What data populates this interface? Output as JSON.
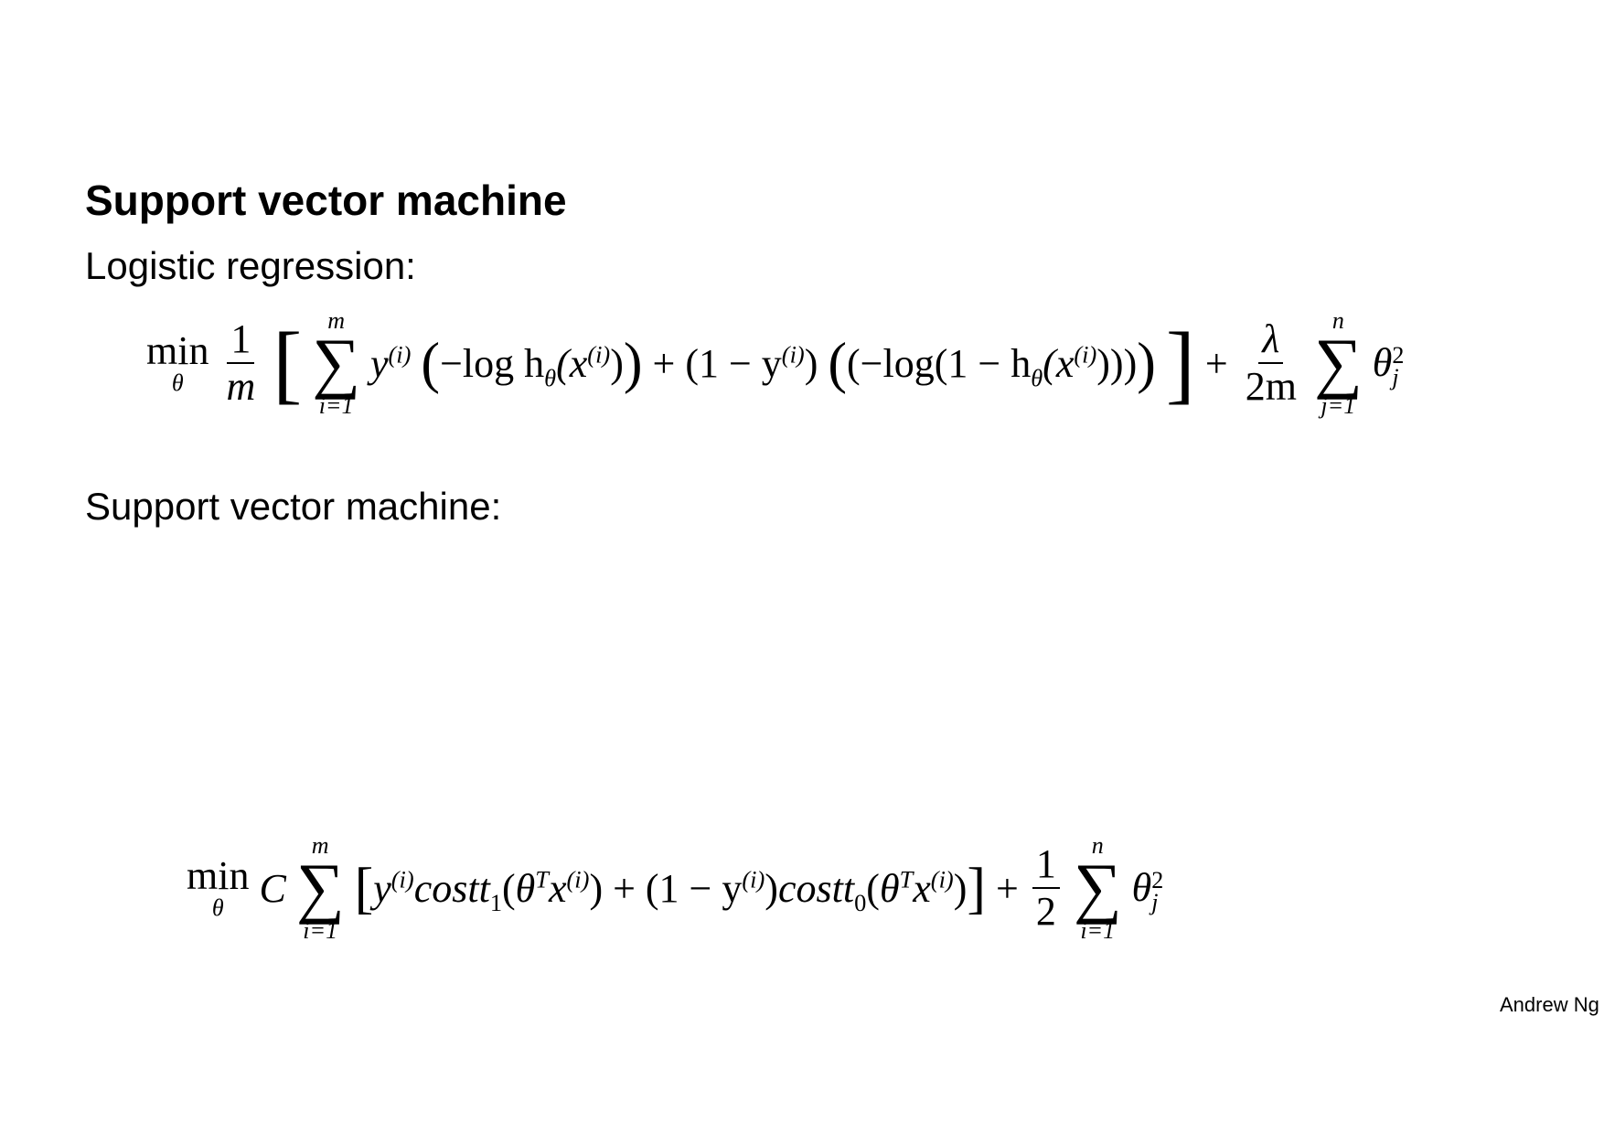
{
  "slide": {
    "title": "Support vector machine",
    "logistic_heading": "Logistic regression:",
    "svm_heading": "Support vector machine:",
    "footer": "Andrew Ng"
  },
  "equations": {
    "logistic": {
      "min": "min",
      "min_sub": "θ",
      "frac1_num": "1",
      "frac1_den": "m",
      "sum1_upper": "m",
      "sum1_lower": "i=1",
      "term1": "y",
      "term1_sup": "(i)",
      "term2": "−log h",
      "term2_sub": "θ",
      "term2_rest": "(x",
      "term2_sup": "(i)",
      "term3": "+ (1 − y",
      "term3_sup": "(i)",
      "term4": "(−log(1 − h",
      "term4_sub": "θ",
      "term4_rest": "(x",
      "term4_sup": "(i)",
      "reg_num": "λ",
      "reg_den": "2m",
      "sum2_upper": "n",
      "sum2_lower": "j=1",
      "theta": "θ",
      "theta_sup": "2",
      "theta_sub": "j"
    },
    "svm": {
      "min": "min",
      "min_sub": "θ",
      "C": "C",
      "sum1_upper": "m",
      "sum1_lower": "i=1",
      "y": "y",
      "y_sup": "(i)",
      "cost1": "cost",
      "cost1_sub": "1",
      "theta": "θ",
      "T": "T",
      "x": "x",
      "x_sup": "(i)",
      "plus_one_minus_y": "+ (1 − y",
      "cost0": "cost",
      "cost0_sub": "0",
      "half_num": "1",
      "half_den": "2",
      "sum2_upper": "n",
      "sum2_lower": "i=1",
      "theta_sup": "2",
      "theta_sub": "j"
    }
  }
}
